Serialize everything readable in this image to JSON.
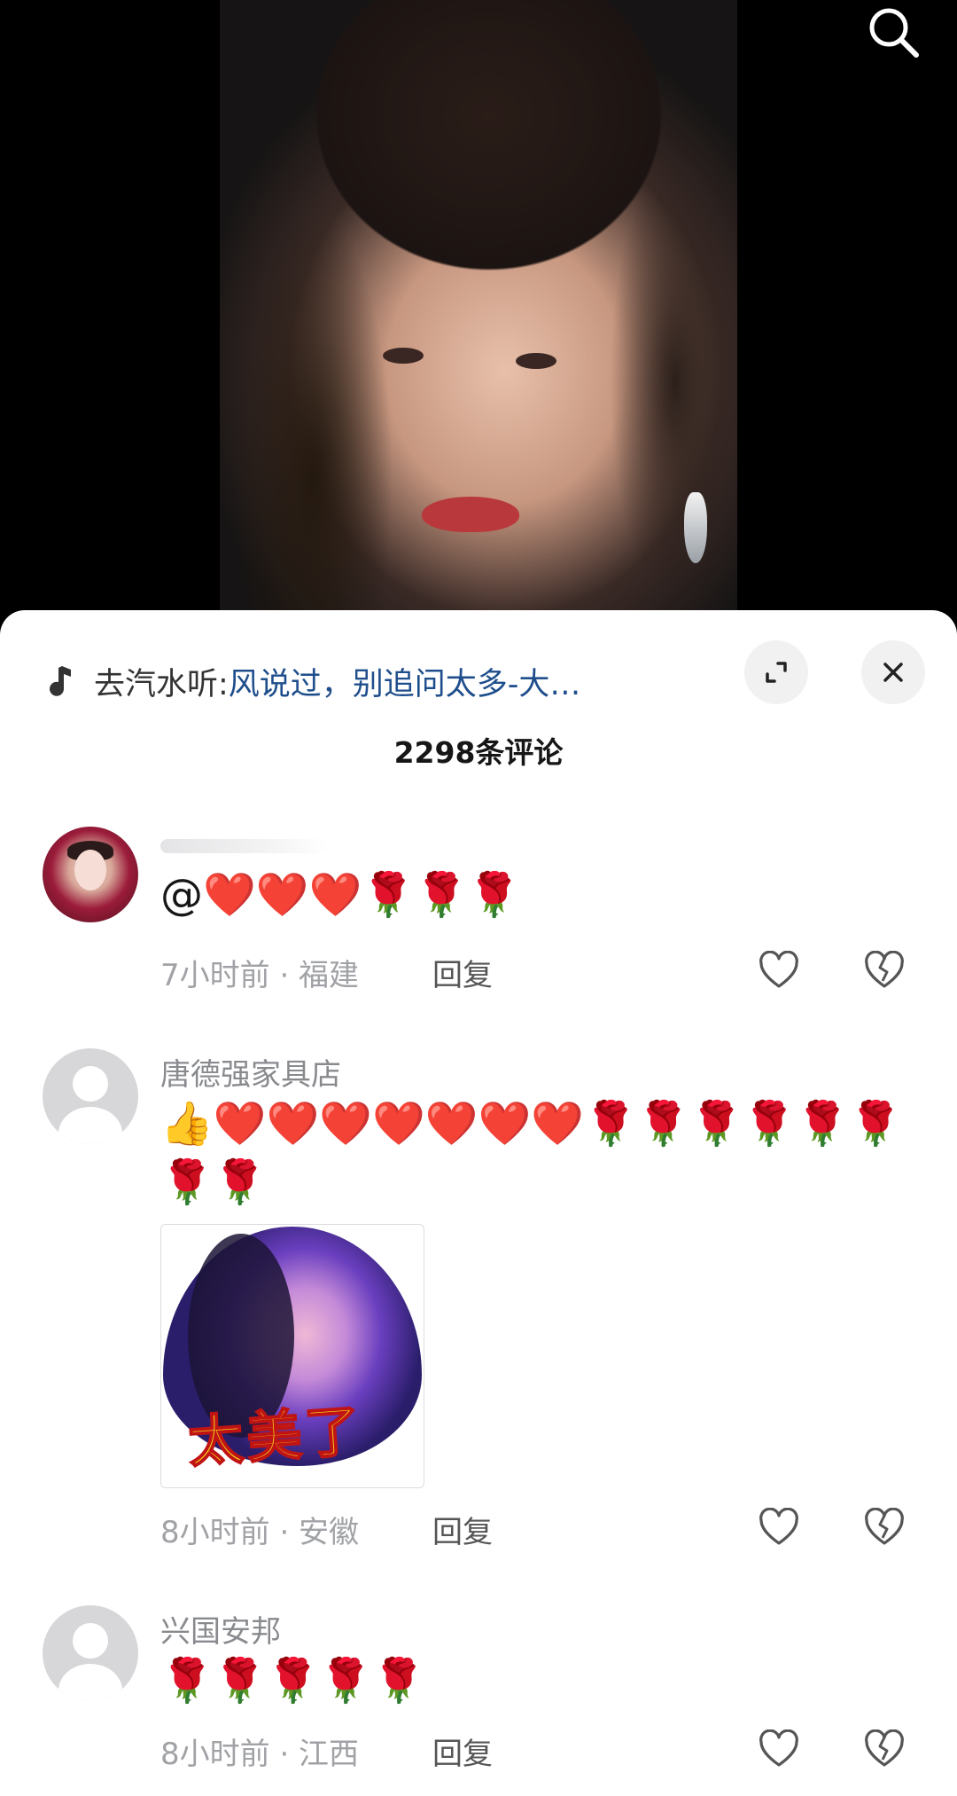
{
  "video": {
    "search_icon": "search-icon"
  },
  "sheet": {
    "music_prefix": "去汽水听: ",
    "music_title": "风说过，别追问太多-大…",
    "expand_icon": "expand-icon",
    "close_icon": "close-icon",
    "comment_count": "2298条评论"
  },
  "comments": [
    {
      "username": "",
      "text": "@❤️❤️❤️🌹🌹🌹",
      "time": "7小时前",
      "location": "福建",
      "meta": "7小时前 · 福建",
      "reply": "回复"
    },
    {
      "username": "唐德强家具店",
      "text": "👍❤️❤️❤️❤️❤️❤️❤️🌹🌹🌹🌹🌹🌹🌹🌹",
      "sticker_text": "太美了",
      "time": "8小时前",
      "location": "安徽",
      "meta": "8小时前 · 安徽",
      "reply": "回复"
    },
    {
      "username": "兴国安邦",
      "text": "🌹🌹🌹🌹🌹",
      "time": "8小时前",
      "location": "江西",
      "meta": "8小时前 · 江西",
      "reply": "回复"
    }
  ]
}
